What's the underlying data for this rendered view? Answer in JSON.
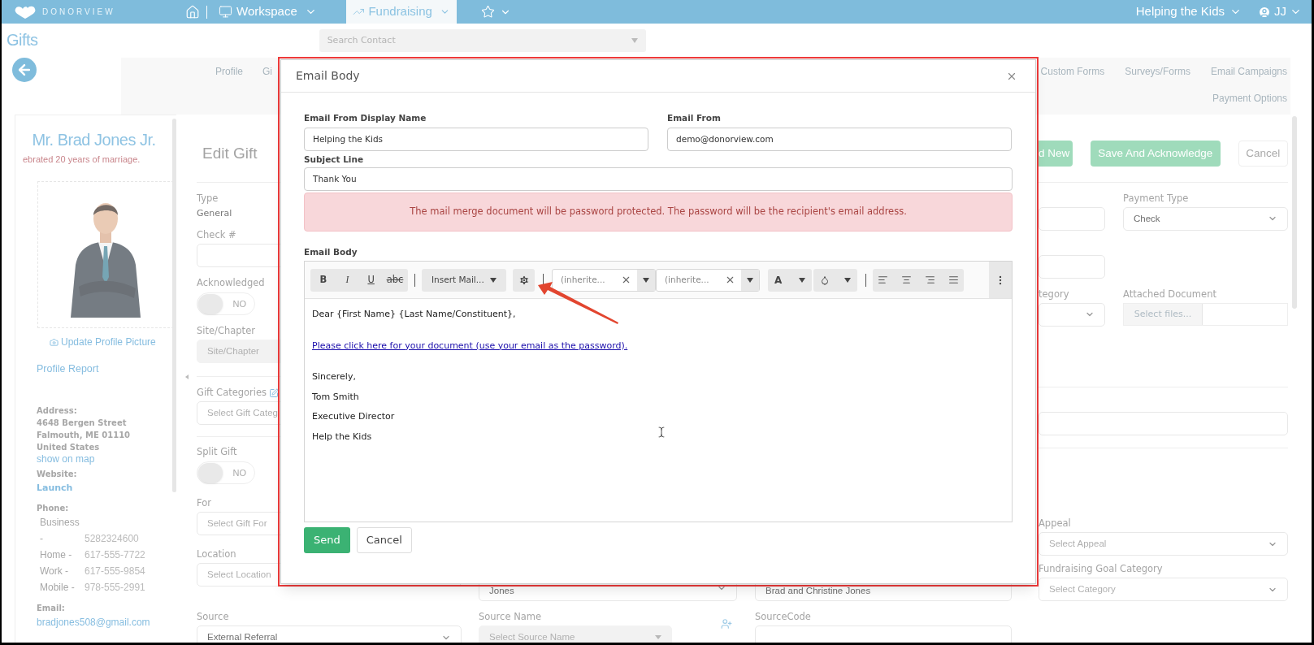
{
  "nav": {
    "brand": "DONORVIEW",
    "menus": [
      {
        "label": "Workspace",
        "selected": false
      },
      {
        "label": "Fundraising",
        "selected": true
      }
    ],
    "org": "Helping the Kids",
    "user": "JJ"
  },
  "header": {
    "title": "Gifts",
    "search": {
      "placeholder": "Search Contact"
    }
  },
  "tabs": {
    "left": [
      {
        "label": "Profile"
      },
      {
        "label": "Gi"
      }
    ],
    "right": [
      {
        "label": "Custom Forms"
      },
      {
        "label": "Surveys/Forms"
      },
      {
        "label": "Email Campaigns"
      }
    ],
    "second_row": [
      {
        "label": "Payment Options"
      }
    ]
  },
  "sidebar": {
    "name": "Mr. Brad Jones Jr.",
    "note": "ebrated 20 years of marriage.",
    "update_picture": "Update Profile Picture",
    "profile_report": "Profile Report",
    "address": {
      "label": "Address:",
      "lines": [
        "4648 Bergen Street",
        "Falmouth, ME 01110",
        "United States"
      ],
      "map_link": "show on map"
    },
    "website": {
      "label": "Website:",
      "link": "Launch"
    },
    "phone": {
      "label": "Phone:",
      "entries": [
        {
          "type": "Business -",
          "number": "5282324600"
        },
        {
          "type": "Home -",
          "number": "617-555-7722"
        },
        {
          "type": "Work -",
          "number": "617-555-9854"
        },
        {
          "type": "Mobile -",
          "number": "978-555-2991"
        }
      ]
    },
    "email": {
      "label": "Email:",
      "value": "bradjones508@gmail.com"
    }
  },
  "form": {
    "title": "Edit Gift",
    "buttons": [
      {
        "label": "d New",
        "kind": "primary"
      },
      {
        "label": "Save And Acknowledge",
        "kind": "primary"
      },
      {
        "label": "Cancel",
        "kind": "default"
      }
    ],
    "left_sections": [
      [
        {
          "kind": "static",
          "label": "Type",
          "value": "General"
        },
        {
          "kind": "input",
          "label": "Check #"
        },
        {
          "kind": "toggle",
          "label": "Acknowledged",
          "on": false,
          "state_text": "NO"
        },
        {
          "kind": "input",
          "label": "Site/Chapter",
          "placeholder": "Site/Chapter",
          "disabled": true
        }
      ],
      [
        {
          "kind": "input",
          "label": "Gift Categories",
          "placeholder": "Select Gift Categ",
          "edit_icon": true
        }
      ],
      [
        {
          "kind": "toggle",
          "label": "Split Gift",
          "on": false,
          "state_text": "NO"
        },
        {
          "kind": "select",
          "label": "For",
          "placeholder": "Select Gift For"
        },
        {
          "kind": "select",
          "label": "Location",
          "placeholder": "Select Location"
        }
      ]
    ],
    "right_rows": [
      [
        {
          "kind": "input"
        },
        {
          "kind": "select",
          "label": "Payment Type",
          "value": "Check"
        }
      ],
      [
        {
          "kind": "input"
        }
      ],
      [
        {
          "kind": "select",
          "label": "tegory"
        },
        {
          "kind": "file",
          "label": "Attached Document",
          "button": "Select files..."
        }
      ]
    ],
    "right_wide_field": {
      "kind": "input"
    },
    "right_bottom": [
      {
        "kind": "select",
        "label": "Appeal",
        "placeholder": "Select Appeal"
      },
      {
        "kind": "select",
        "label": "Fundraising Goal Category",
        "placeholder": "Select Category"
      }
    ],
    "middle_fields": [
      {
        "kind": "select",
        "value": "Jones"
      },
      {
        "kind": "input",
        "value": "Brad and Christine Jones"
      }
    ],
    "bottom_fields": [
      {
        "kind": "select",
        "label": "Source",
        "value": "External Referral"
      },
      {
        "kind": "select",
        "label": "Source Name",
        "placeholder": "Select Source Name",
        "disabled": true,
        "add_button": true
      },
      {
        "kind": "input",
        "label": "SourceCode"
      }
    ]
  },
  "modal": {
    "title": "Email Body",
    "fields": [
      {
        "label": "Email From Display Name",
        "value": "Helping the Kids"
      },
      {
        "label": "Email From",
        "value": "demo@donorview.com"
      }
    ],
    "subject": {
      "label": "Subject Line",
      "value": "Thank You"
    },
    "alert": "The mail merge document will be password protected. The password will be the recipient's email address.",
    "editor": {
      "label": "Email Body",
      "toolbar": {
        "format_buttons": [
          "B",
          "I",
          "U",
          "abc"
        ],
        "insert": "Insert Mail...",
        "fonts": [
          {
            "value": "(inherite..."
          },
          {
            "value": "(inherite..."
          }
        ],
        "text_color": "A"
      },
      "body": [
        {
          "kind": "text",
          "text": "Dear {First Name} {Last Name/Constituent},"
        },
        {
          "kind": "blank"
        },
        {
          "kind": "link",
          "text": "Please click here for your document (use your email as the password)."
        },
        {
          "kind": "blank"
        },
        {
          "kind": "text",
          "text": "Sincerely,"
        },
        {
          "kind": "text",
          "text": "Tom Smith"
        },
        {
          "kind": "text",
          "text": "Executive Director"
        },
        {
          "kind": "text",
          "text": "Help the Kids"
        }
      ]
    },
    "buttons": [
      {
        "label": "Send",
        "kind": "primary"
      },
      {
        "label": "Cancel",
        "kind": "default"
      }
    ]
  }
}
